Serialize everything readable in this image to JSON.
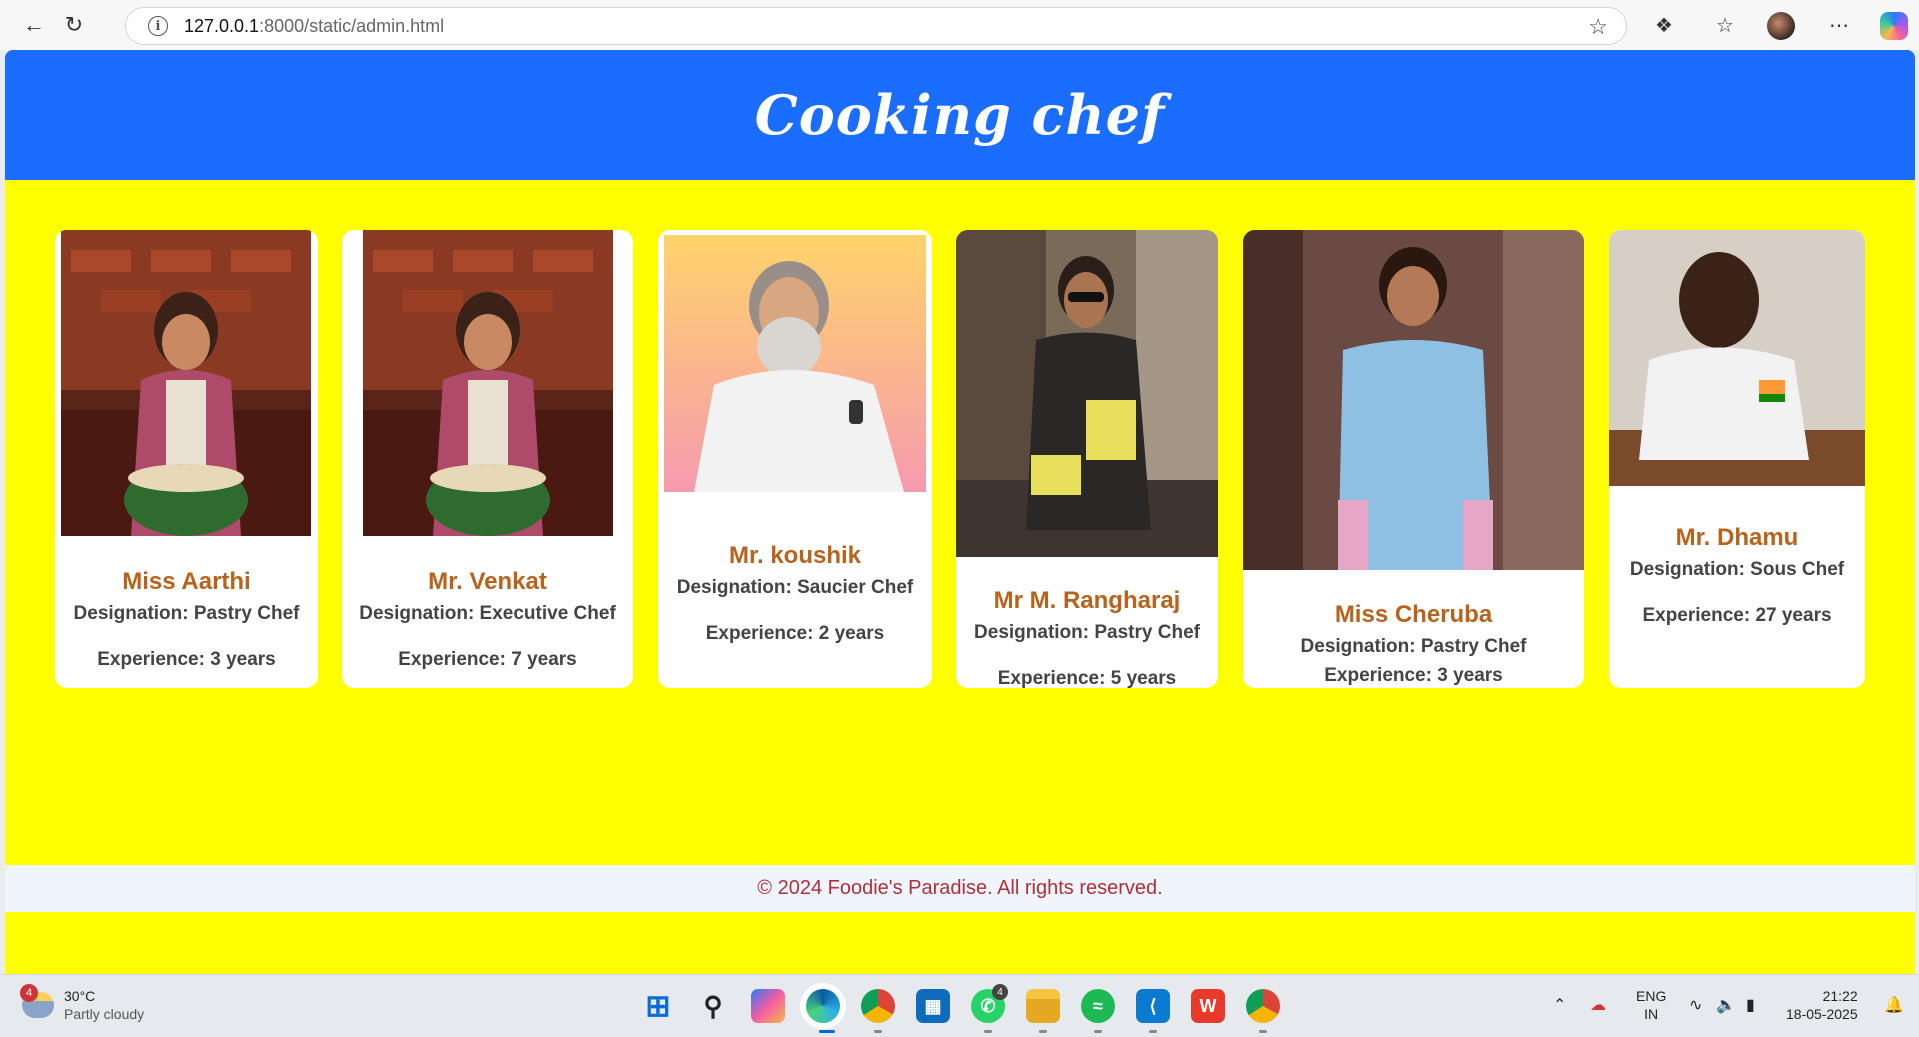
{
  "browser": {
    "url_host": "127.0.0.1",
    "url_path": ":8000/static/admin.html"
  },
  "header": {
    "title": "Cooking chef"
  },
  "chefs": [
    {
      "name": "Miss Aarthi",
      "designation": "Designation: Pastry Chef",
      "experience": "Experience: 3 years"
    },
    {
      "name": "Mr. Venkat",
      "designation": "Designation: Executive Chef",
      "experience": "Experience: 7 years"
    },
    {
      "name": "Mr. koushik",
      "designation": "Designation: Saucier Chef",
      "experience": "Experience: 2 years"
    },
    {
      "name": "Mr M. Rangharaj",
      "designation": "Designation: Pastry Chef",
      "experience": "Experience: 5 years"
    },
    {
      "name": "Miss Cheruba",
      "designation": "Designation: Pastry Chef",
      "experience": "Experience: 3 years"
    },
    {
      "name": "Mr. Dhamu",
      "designation": "Designation: Sous Chef",
      "experience": "Experience: 27 years"
    }
  ],
  "footer": {
    "text": "© 2024 Foodie's Paradise. All rights reserved."
  },
  "taskbar": {
    "weather_temp": "30°C",
    "weather_desc": "Partly cloudy",
    "weather_badge": "4",
    "whatsapp_badge": "4",
    "lang_top": "ENG",
    "lang_bottom": "IN",
    "time": "21:22",
    "date": "18-05-2025"
  },
  "colors": {
    "header_bg": "#1a6dff",
    "page_bg": "#ffff00",
    "name_color": "#b8621b",
    "footer_text": "#b0303a"
  }
}
